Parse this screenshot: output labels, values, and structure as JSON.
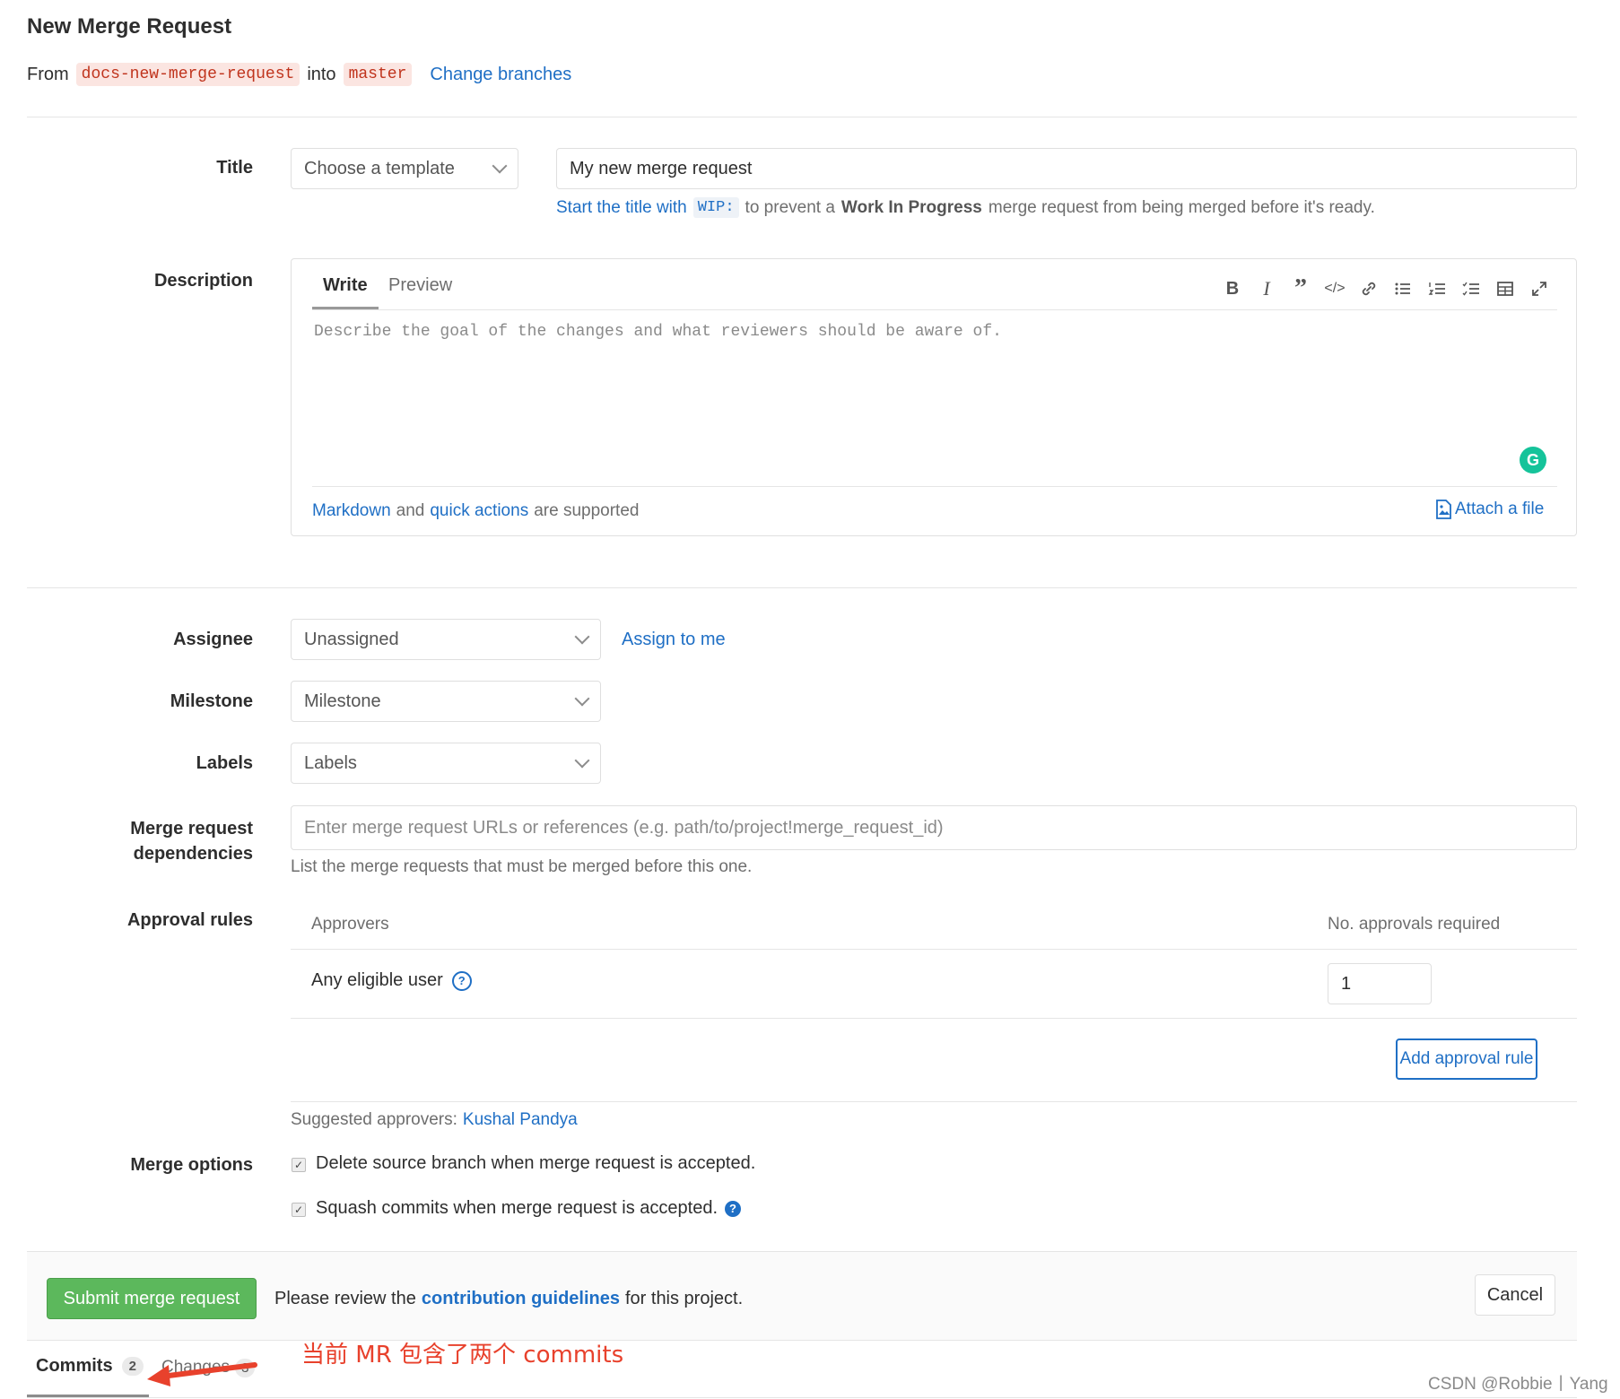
{
  "page_title": "New Merge Request",
  "branch_line": {
    "from_label": "From",
    "source_branch": "docs-new-merge-request",
    "into_label": "into",
    "target_branch": "master",
    "change_branches": "Change branches"
  },
  "title_section": {
    "label": "Title",
    "template_select": "Choose a template",
    "title_value": "My new merge request",
    "hint_link": "Start the title with",
    "hint_code": "WIP:",
    "hint_text_1": "to prevent a",
    "hint_bold": "Work In Progress",
    "hint_text_2": "merge request from being merged before it's ready."
  },
  "description": {
    "label": "Description",
    "tab_write": "Write",
    "tab_preview": "Preview",
    "placeholder": "Describe the goal of the changes and what reviewers should be aware of.",
    "toolbar": [
      "bold-icon",
      "italic-icon",
      "quote-icon",
      "code-icon",
      "link-icon",
      "bullet-list-icon",
      "numbered-list-icon",
      "task-list-icon",
      "table-icon",
      "fullscreen-icon"
    ],
    "grammarly_letter": "G",
    "footer_markdown": "Markdown",
    "footer_and": "and",
    "footer_quick_actions": "quick actions",
    "footer_supported": "are supported",
    "attach_file": "Attach a file"
  },
  "assignee": {
    "label": "Assignee",
    "value": "Unassigned",
    "assign_to_me": "Assign to me"
  },
  "milestone": {
    "label": "Milestone",
    "value": "Milestone"
  },
  "labels": {
    "label": "Labels",
    "value": "Labels"
  },
  "dependencies": {
    "label_line1": "Merge request",
    "label_line2": "dependencies",
    "placeholder": "Enter merge request URLs or references (e.g. path/to/project!merge_request_id)",
    "help": "List the merge requests that must be merged before this one."
  },
  "approval_rules": {
    "label": "Approval rules",
    "col_approvers": "Approvers",
    "col_required": "No. approvals required",
    "row_name": "Any eligible user",
    "row_required": "1",
    "add_rule_button": "Add approval rule",
    "suggested_label": "Suggested approvers:",
    "suggested_name": "Kushal Pandya"
  },
  "merge_options": {
    "label": "Merge options",
    "delete_source": "Delete source branch when merge request is accepted.",
    "squash": "Squash commits when merge request is accepted."
  },
  "footer": {
    "submit": "Submit merge request",
    "review_text_1": "Please review the",
    "guidelines": "contribution guidelines",
    "review_text_2": "for this project.",
    "cancel": "Cancel"
  },
  "bottom_tabs": {
    "commits_label": "Commits",
    "commits_count": "2",
    "changes_label": "Changes",
    "changes_count": "3"
  },
  "annotation": "当前 MR 包含了两个 commits",
  "watermark": "CSDN @Robbie丨Yang",
  "colors": {
    "link": "#1f6fc5",
    "submit_green": "#5cb85c",
    "annotation_red": "#e8412c",
    "branch_pill_bg": "#fbe5e1",
    "branch_pill_text": "#c0341d"
  }
}
